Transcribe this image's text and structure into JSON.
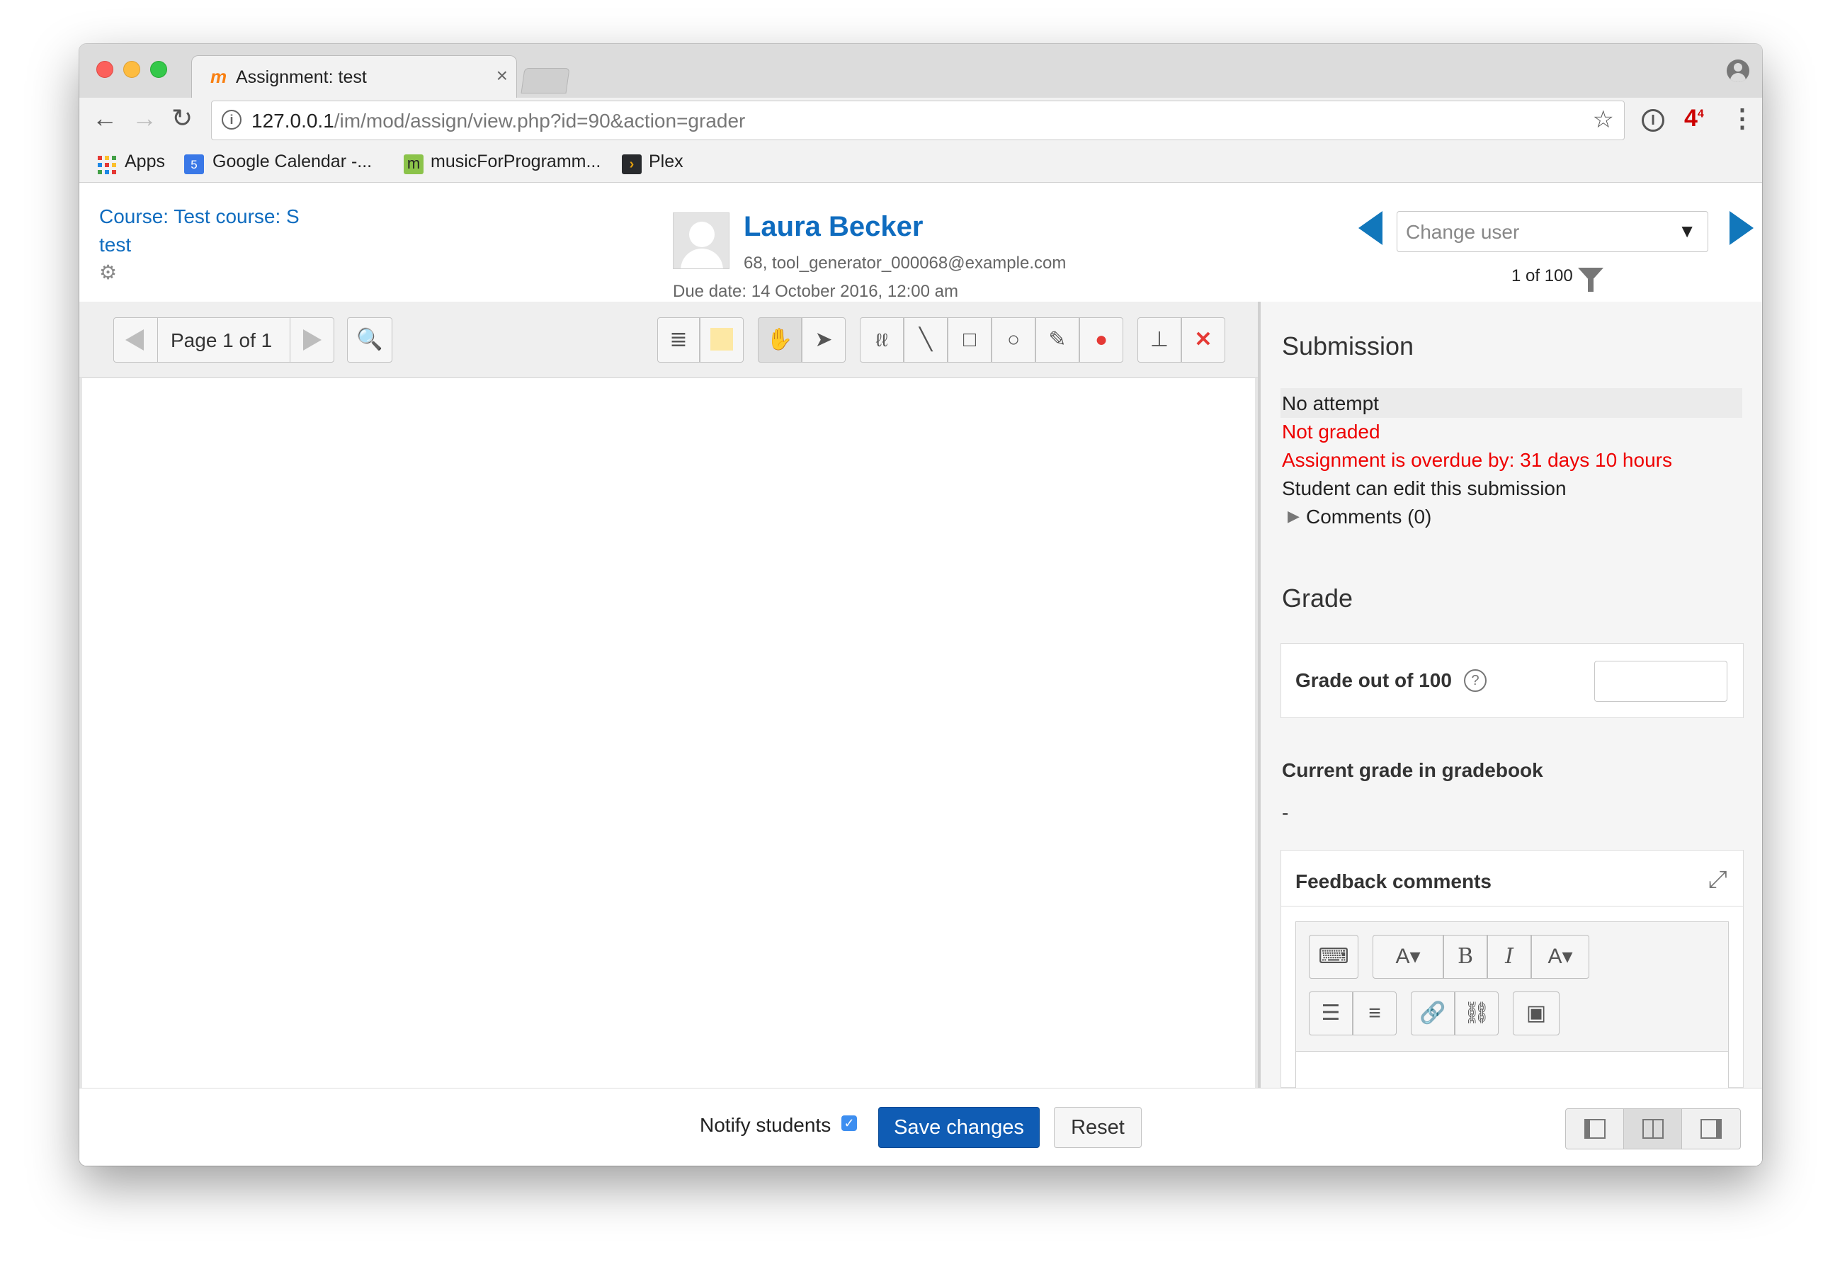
{
  "browser": {
    "tab_title": "Assignment: test",
    "url_host": "127.0.0.1",
    "url_path": "/im/mod/assign/view.php?id=90&action=grader",
    "extension_badge": "4",
    "extension_badge_sup": "4",
    "bookmarks": [
      "Apps",
      "Google Calendar -...",
      "musicForProgramm...",
      "Plex"
    ],
    "gcal_day": "5"
  },
  "header": {
    "course_link": "Course: Test course: S",
    "assignment_link": "test",
    "user_name": "Laura Becker",
    "user_info": "68, tool_generator_000068@example.com",
    "due_date": "Due date: 14 October 2016, 12:00 am",
    "change_user_placeholder": "Change user",
    "user_count": "1 of 100"
  },
  "editor": {
    "page_indicator": "Page 1 of 1"
  },
  "submission": {
    "heading": "Submission",
    "status": "No attempt",
    "grading_status": "Not graded",
    "overdue": "Assignment is overdue by: 31 days 10 hours",
    "edit_status": "Student can edit this submission",
    "comments_link": "Comments (0)"
  },
  "grade": {
    "heading": "Grade",
    "grade_label": "Grade out of 100",
    "grade_value": "",
    "current_grade_label": "Current grade in gradebook",
    "current_grade_value": "-",
    "feedback_label": "Feedback comments"
  },
  "footer": {
    "notify_label": "Notify students",
    "notify_checked": true,
    "save_label": "Save changes",
    "reset_label": "Reset"
  },
  "colors": {
    "link": "#0f6cbf",
    "primary_button": "#0f5cb4",
    "error": "#e00000",
    "nav_arrow": "#1177bb"
  }
}
